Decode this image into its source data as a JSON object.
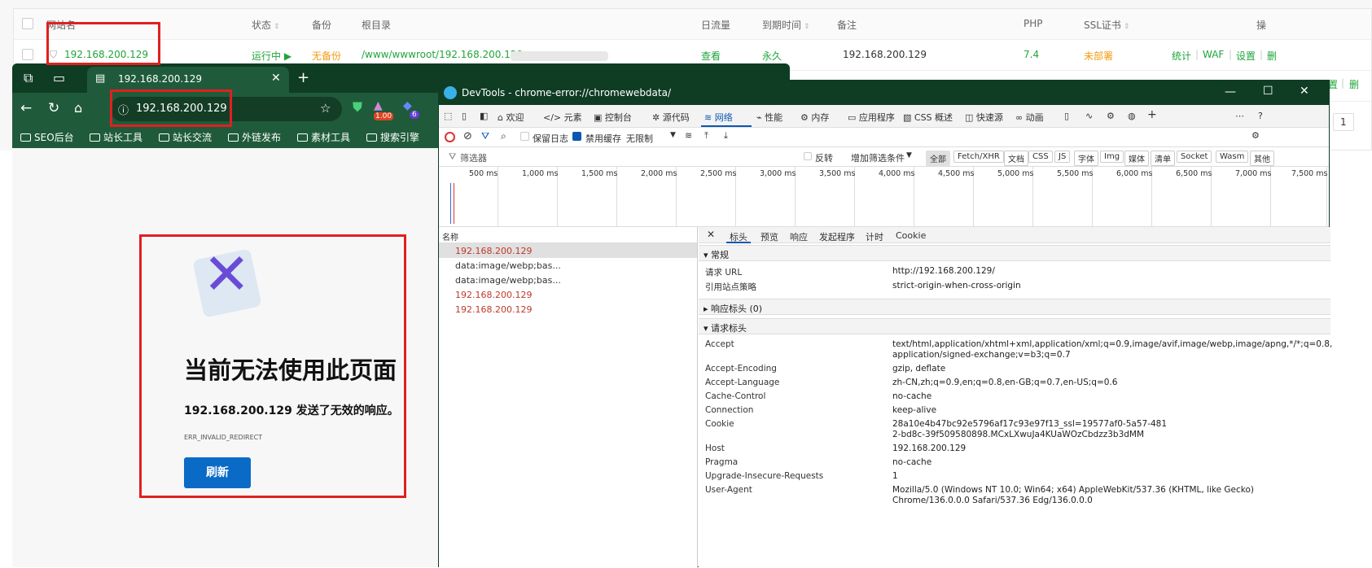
{
  "bt_panel": {
    "headers": {
      "site": "网站名",
      "status": "状态",
      "backup": "备份",
      "root": "根目录",
      "traffic": "日流量",
      "expire": "到期时间",
      "note": "备注",
      "php": "PHP",
      "ssl": "SSL证书",
      "ops": "操"
    },
    "row": {
      "site": "192.168.200.129",
      "status": "运行中 ▶",
      "backup": "无备份",
      "root": "/www/wwwroot/192.168.200.129",
      "traffic": "查看",
      "expire": "永久",
      "note": "192.168.200.129",
      "php": "7.4",
      "ssl": "未部署",
      "ops": [
        "统计",
        "WAF",
        "设置",
        "删"
      ]
    },
    "row2_ops": [
      "设置",
      "删"
    ],
    "pager": "1"
  },
  "browser": {
    "tab_title": "192.168.200.129",
    "url": "192.168.200.129",
    "badge1": "1.00",
    "badge2": "6",
    "bookmarks": [
      "SEO后台",
      "站长工具",
      "站长交流",
      "外链发布",
      "素材工具",
      "搜索引擎"
    ],
    "error_title": "当前无法使用此页面",
    "error_desc": "192.168.200.129 发送了无效的响应。",
    "error_code": "ERR_INVALID_REDIRECT",
    "refresh": "刷新"
  },
  "devtools": {
    "title": "DevTools - chrome-error://chromewebdata/",
    "tabs": [
      "欢迎",
      "元素",
      "控制台",
      "源代码",
      "网络",
      "性能",
      "内存",
      "应用程序",
      "CSS 概述",
      "快速源",
      "动画"
    ],
    "active_tab": "网络",
    "toolbar": {
      "preserve_log": "保留日志",
      "disable_cache": "禁用缓存",
      "throttle": "无限制"
    },
    "filter": {
      "placeholder": "筛选器",
      "invert": "反转",
      "more": "增加筛选条件",
      "types": [
        "全部",
        "Fetch/XHR",
        "文档",
        "CSS",
        "JS",
        "字体",
        "Img",
        "媒体",
        "清单",
        "Socket",
        "Wasm",
        "其他"
      ]
    },
    "timeline": [
      "500 ms",
      "1,000 ms",
      "1,500 ms",
      "2,000 ms",
      "2,500 ms",
      "3,000 ms",
      "3,500 ms",
      "4,000 ms",
      "4,500 ms",
      "5,000 ms",
      "5,500 ms",
      "6,000 ms",
      "6,500 ms",
      "7,000 ms",
      "7,500 ms"
    ],
    "list_header": "名称",
    "requests": [
      "192.168.200.129",
      "data:image/webp;bas...",
      "data:image/webp;bas...",
      "192.168.200.129",
      "192.168.200.129"
    ],
    "detail_tabs": [
      "标头",
      "预览",
      "响应",
      "发起程序",
      "计时",
      "Cookie"
    ],
    "general_label": "▾ 常规",
    "general": [
      {
        "k": "请求 URL",
        "v": "http://192.168.200.129/"
      },
      {
        "k": "引用站点策略",
        "v": "strict-origin-when-cross-origin"
      }
    ],
    "response_headers": "▸ 响应标头 (0)",
    "request_headers_label": "▾ 请求标头",
    "request_headers": [
      {
        "k": "Accept",
        "v": "text/html,application/xhtml+xml,application/xml;q=0.9,image/avif,image/webp,image/apng,*/*;q=0.8, application/signed-exchange;v=b3;q=0.7"
      },
      {
        "k": "Accept-Encoding",
        "v": "gzip, deflate"
      },
      {
        "k": "Accept-Language",
        "v": "zh-CN,zh;q=0.9,en;q=0.8,en-GB;q=0.7,en-US;q=0.6"
      },
      {
        "k": "Cache-Control",
        "v": "no-cache"
      },
      {
        "k": "Connection",
        "v": "keep-alive"
      },
      {
        "k": "Cookie",
        "v": "28a10e4b47bc92e5796af17c93e97f13_ssl=19577af0-5a57-4812-bd8c-39f509580898.MCxLXwuJa4KUaWOzCbdzz3b3dMM"
      },
      {
        "k": "Host",
        "v": "192.168.200.129"
      },
      {
        "k": "Pragma",
        "v": "no-cache"
      },
      {
        "k": "Upgrade-Insecure-Requests",
        "v": "1"
      },
      {
        "k": "User-Agent",
        "v": "Mozilla/5.0 (Windows NT 10.0; Win64; x64) AppleWebKit/537.36 (KHTML, like Gecko) Chrome/136.0.0.0 Safari/537.36 Edg/136.0.0.0"
      }
    ]
  }
}
